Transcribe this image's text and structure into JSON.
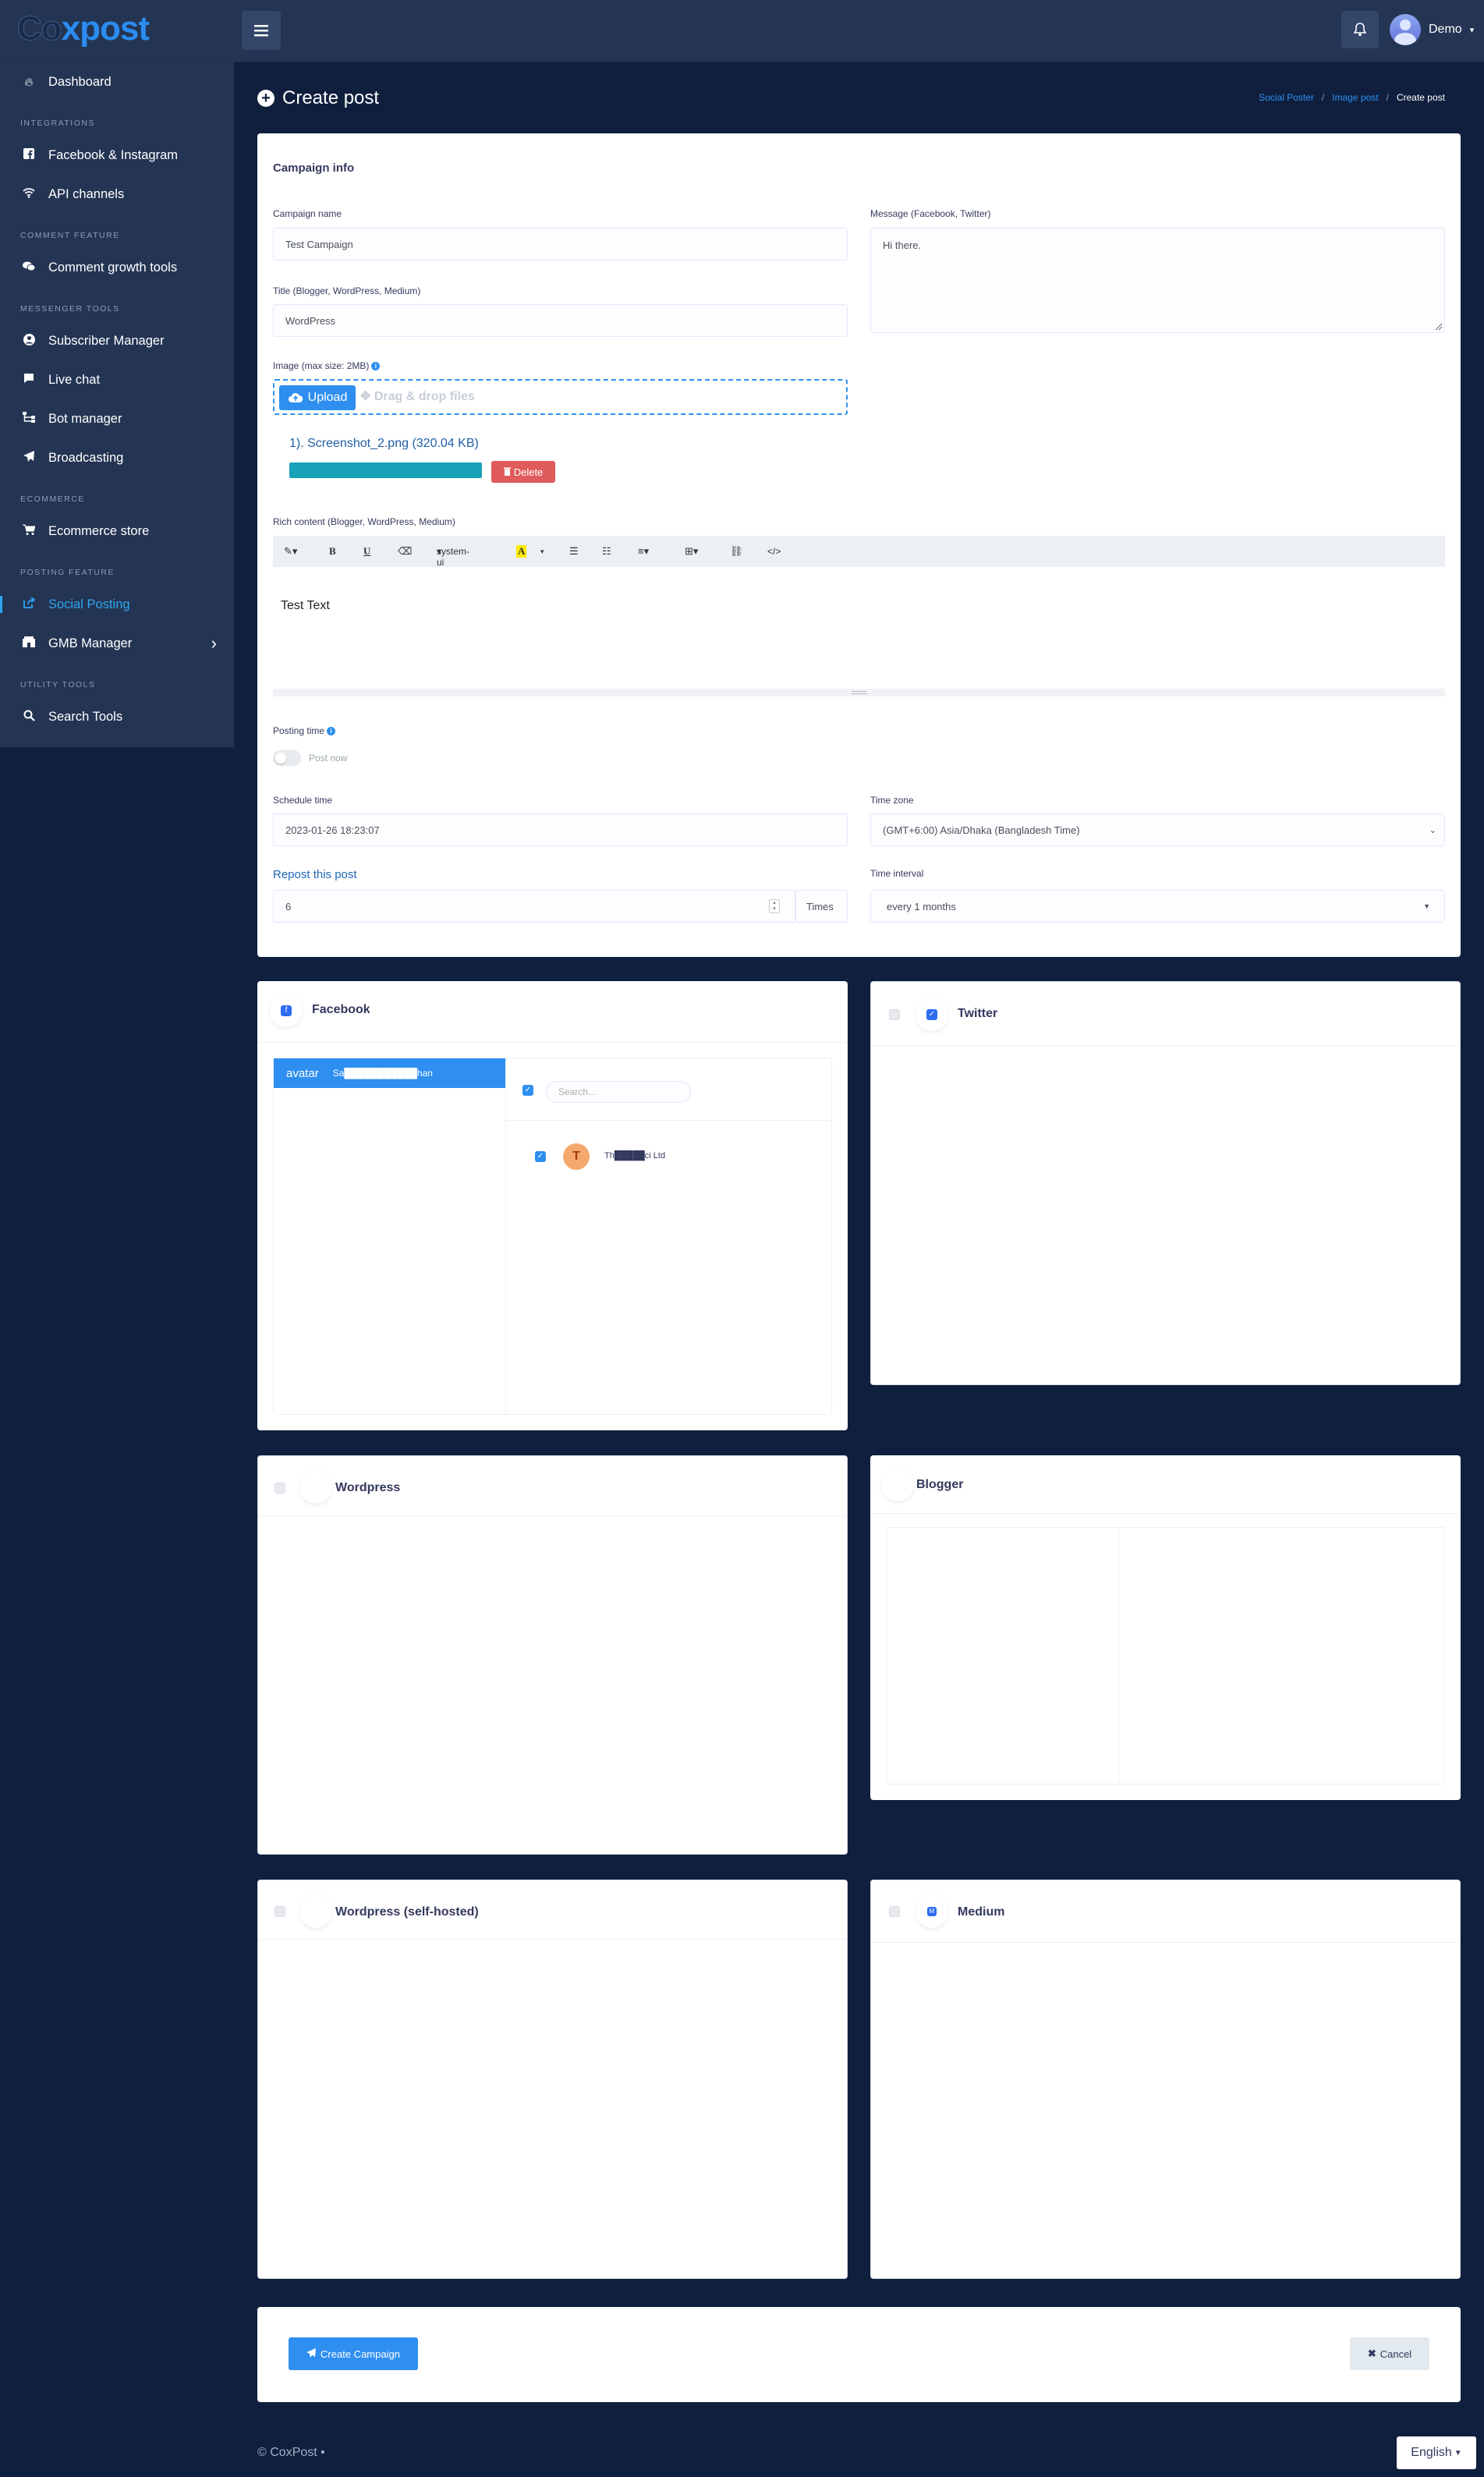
{
  "app": {
    "logo_co": "Co",
    "logo_rest": "xpost"
  },
  "topbar": {
    "user_name": "Demo",
    "user_caret": "▾"
  },
  "sidebar": {
    "items": [
      {
        "label": "Dashboard",
        "icon": "fire-icon"
      },
      {
        "header": "INTEGRATIONS"
      },
      {
        "label": "Facebook & Instagram",
        "icon": "facebook-icon"
      },
      {
        "label": "API channels",
        "icon": "wifi-icon"
      },
      {
        "header": "COMMENT FEATURE"
      },
      {
        "label": "Comment growth tools",
        "icon": "comments-icon"
      },
      {
        "header": "MESSENGER TOOLS"
      },
      {
        "label": "Subscriber Manager",
        "icon": "user-circle-icon"
      },
      {
        "label": "Live chat",
        "icon": "comment-icon"
      },
      {
        "label": "Bot manager",
        "icon": "sitemap-icon"
      },
      {
        "label": "Broadcasting",
        "icon": "paper-plane-icon"
      },
      {
        "header": "ECOMMERCE"
      },
      {
        "label": "Ecommerce store",
        "icon": "cart-icon"
      },
      {
        "header": "POSTING FEATURE"
      },
      {
        "label": "Social Posting",
        "icon": "share-icon",
        "active": true
      },
      {
        "label": "GMB Manager",
        "icon": "gmb-icon",
        "arrow": "›"
      },
      {
        "header": "UTILITY TOOLS"
      },
      {
        "label": "Search Tools",
        "icon": "search-icon"
      }
    ]
  },
  "page": {
    "title": "Create post",
    "breadcrumb": [
      "Social Poster",
      "Image post",
      "Create post"
    ]
  },
  "campaign": {
    "card_title": "Campaign info",
    "campaign_name_label": "Campaign name",
    "campaign_name_value": "Test Campaign",
    "message_label": "Message (Facebook, Twitter)",
    "message_value": "Hi there.",
    "title_label": "Title (Blogger, WordPress, Medium)",
    "title_value": "WordPress",
    "image_label": "Image (max size: 2MB)",
    "upload_label": "Upload",
    "drag_drop_label": "Drag & drop files",
    "file_name": "1). Screenshot_2.png (320.04 KB)",
    "upload_progress_pct": 100,
    "delete_label": "Delete",
    "rich_content_label": "Rich content (Blogger, WordPress, Medium)",
    "toolbar": {
      "font": "system-ui"
    },
    "rich_content_value": "Test Text",
    "posting_time_label": "Posting time",
    "post_now_label": "Post now",
    "schedule_time_label": "Schedule time",
    "schedule_time_value": "2023-01-26 18:23:07",
    "time_zone_label": "Time zone",
    "time_zone_value": "(GMT+6:00) Asia/Dhaka (Bangladesh Time)",
    "repost_label": "Repost this post",
    "repost_value": "6",
    "times_label": "Times",
    "time_interval_label": "Time interval",
    "time_interval_value": "every 1 months"
  },
  "platforms": {
    "facebook": {
      "title": "Facebook",
      "account_name": "Sa███████████han",
      "avatar_alt": "avatar",
      "search_placeholder": "Search...",
      "page_initial": "T",
      "page_name": "Th█████ci Ltd"
    },
    "twitter": {
      "title": "Twitter"
    },
    "wordpress": {
      "title": "Wordpress"
    },
    "blogger": {
      "title": "Blogger"
    },
    "wordpress_self": {
      "title": "Wordpress (self-hosted)"
    },
    "medium": {
      "title": "Medium"
    }
  },
  "actions": {
    "create_label": "Create Campaign",
    "cancel_label": "Cancel"
  },
  "footer": {
    "copyright": "© CoxPost",
    "dot": "•",
    "language": "English"
  },
  "colors": {
    "accent": "#2e8ff0",
    "bg": "#0f1f3d",
    "sidebar": "#243553",
    "danger": "#e05b5b",
    "progress": "#17a2b8"
  }
}
